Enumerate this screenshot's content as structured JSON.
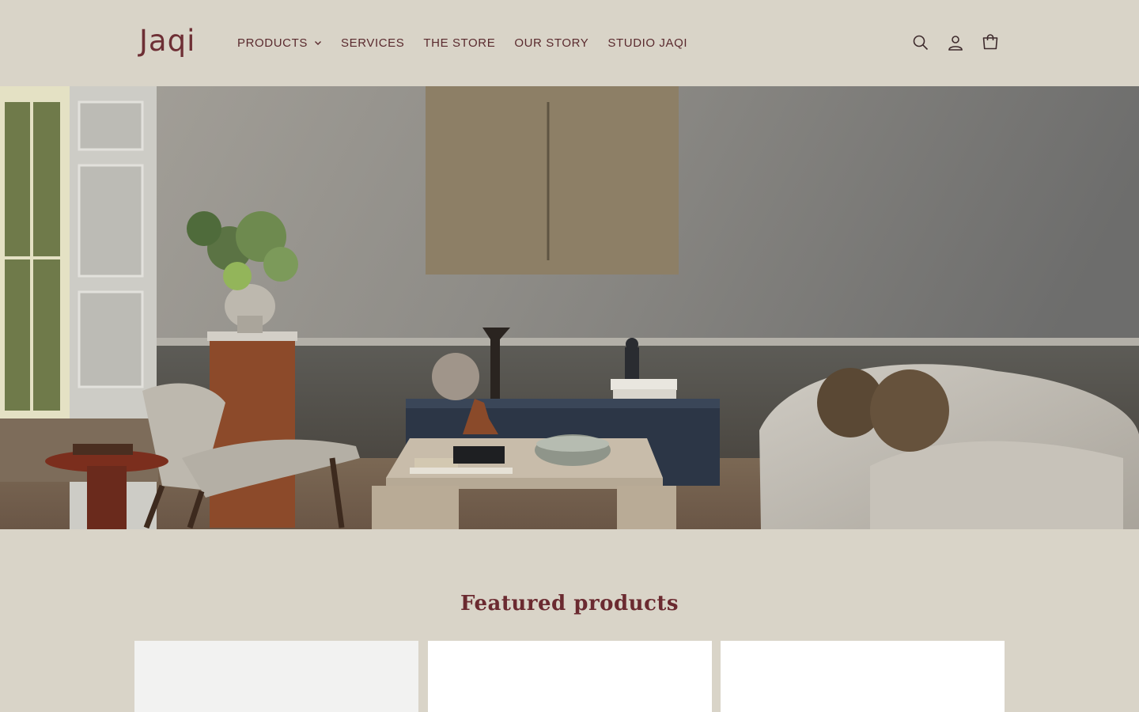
{
  "brand": {
    "logo_text": "Jaqi"
  },
  "nav": {
    "items": [
      {
        "label": "PRODUCTS",
        "has_dropdown": true
      },
      {
        "label": "SERVICES"
      },
      {
        "label": "THE STORE"
      },
      {
        "label": "OUR STORY"
      },
      {
        "label": "STUDIO JAQI"
      }
    ]
  },
  "header_icons": [
    "search-icon",
    "account-icon",
    "cart-icon"
  ],
  "featured": {
    "title": "Featured products"
  },
  "colors": {
    "background": "#d9d4c8",
    "text": "#5a2a2e",
    "accent": "#6b2a30"
  }
}
